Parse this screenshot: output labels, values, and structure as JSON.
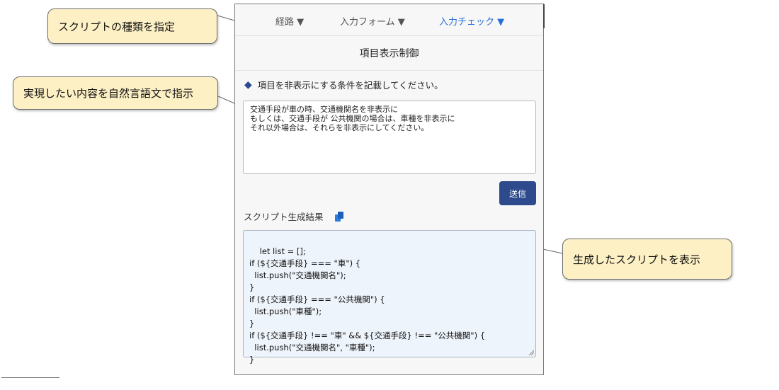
{
  "annotations": {
    "script_type": "スクリプトの種類を指定",
    "natural_language": "実現したい内容を自然言語文で指示",
    "generated": "生成したスクリプトを表示"
  },
  "nav": {
    "tabs": [
      {
        "label": "経路 ▼"
      },
      {
        "label": "入力フォーム ▼"
      },
      {
        "label": "入力チェック ▼",
        "active": true
      }
    ]
  },
  "title": "項目表示制御",
  "condition": {
    "label": "項目を非表示にする条件を記載してください。",
    "value": "交通手段が車の時、交通機関名を非表示に\nもしくは、交通手段が 公共機関の場合は、車種を非表示に\nそれ以外場合は、それらを非表示にしてください。"
  },
  "send_label": "送信",
  "result": {
    "label": "スクリプト生成結果",
    "code": "let list = [];\nif (${交通手段} === \"車\") {\n  list.push(\"交通機関名\");\n}\nif (${交通手段} === \"公共機関\") {\n  list.push(\"車種\");\n}\nif (${交通手段} !== \"車\" && ${交通手段} !== \"公共機関\") {\n  list.push(\"交通機関名\", \"車種\");\n}"
  },
  "icons": {
    "section_marker": "diamond-icon",
    "copy": "copy-icon"
  },
  "colors": {
    "accent": "#2c4a8c",
    "active_tab": "#2a6fd6",
    "callout_bg": "#fdf0c4",
    "code_bg": "#eef4fb"
  }
}
